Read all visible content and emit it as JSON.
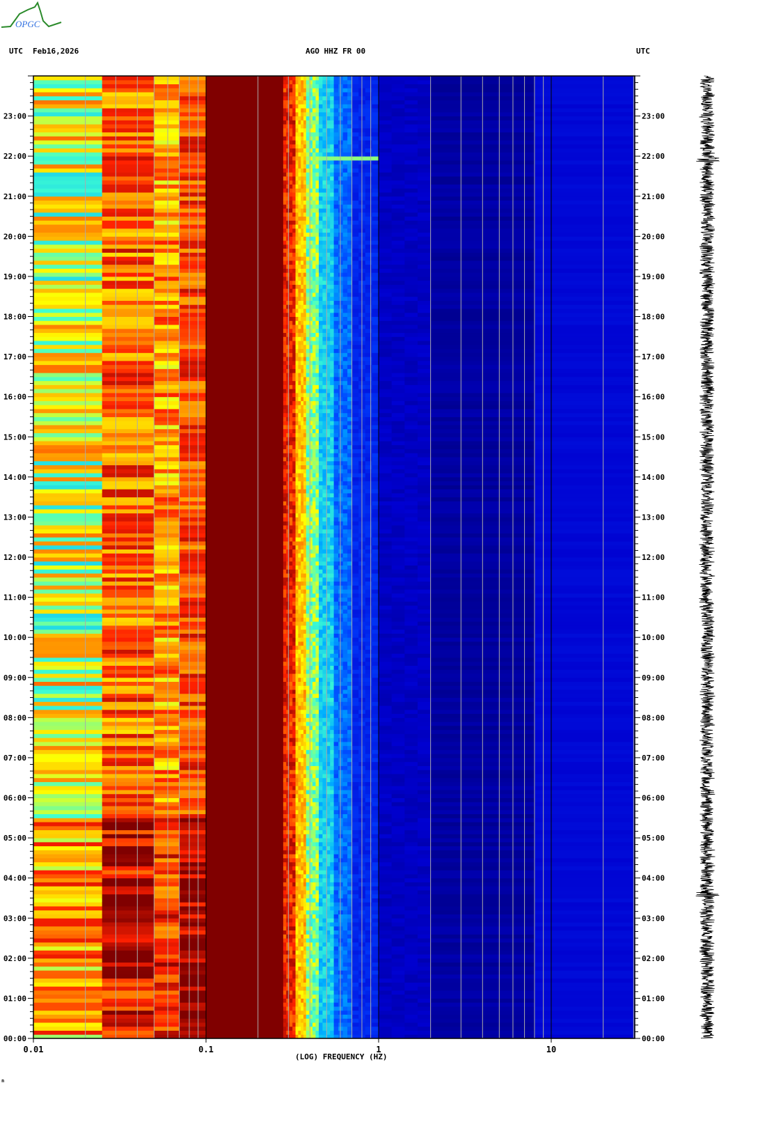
{
  "header": {
    "logo_text": "OPGC",
    "left_tz": "UTC",
    "date": "Feb16,2026",
    "station": "AGO HHZ FR 00",
    "right_tz": "UTC"
  },
  "footer_mark": "n",
  "chart_data": {
    "type": "heatmap",
    "title": "AGO HHZ FR 00",
    "xlabel": "(LOG) FREQUENCY (HZ)",
    "xscale": "log",
    "xlim": [
      0.01,
      30
    ],
    "x_ticks": [
      0.01,
      0.1,
      1,
      10
    ],
    "x_tick_labels": [
      "0.01",
      "0.1",
      "1",
      "10"
    ],
    "ylabel": "UTC",
    "ylim_hours": [
      0,
      24
    ],
    "y_tick_labels": [
      "00:00",
      "01:00",
      "02:00",
      "03:00",
      "04:00",
      "05:00",
      "06:00",
      "07:00",
      "08:00",
      "09:00",
      "10:00",
      "11:00",
      "12:00",
      "13:00",
      "14:00",
      "15:00",
      "16:00",
      "17:00",
      "18:00",
      "19:00",
      "20:00",
      "21:00",
      "22:00",
      "23:00"
    ],
    "colormap": [
      "#00008c",
      "#0000d0",
      "#0040ff",
      "#00b0ff",
      "#40ffd0",
      "#ffff00",
      "#ffa000",
      "#ff2000",
      "#800000"
    ],
    "bands": [
      {
        "f0": 0.01,
        "f1": 0.025,
        "level": 0.62,
        "noise": 0.18
      },
      {
        "f0": 0.025,
        "f1": 0.05,
        "level": 0.8,
        "noise": 0.14
      },
      {
        "f0": 0.05,
        "f1": 0.07,
        "level": 0.74,
        "noise": 0.14
      },
      {
        "f0": 0.07,
        "f1": 0.1,
        "level": 0.84,
        "noise": 0.1
      },
      {
        "f0": 0.1,
        "f1": 0.28,
        "level": 1.0,
        "noise": 0.0
      },
      {
        "f0": 0.28,
        "f1": 0.33,
        "level": 0.88,
        "noise": 0.08
      },
      {
        "f0": 0.33,
        "f1": 0.38,
        "level": 0.7,
        "noise": 0.08
      },
      {
        "f0": 0.38,
        "f1": 0.45,
        "level": 0.55,
        "noise": 0.08
      },
      {
        "f0": 0.45,
        "f1": 0.55,
        "level": 0.42,
        "noise": 0.06
      },
      {
        "f0": 0.55,
        "f1": 0.7,
        "level": 0.3,
        "noise": 0.05
      },
      {
        "f0": 0.7,
        "f1": 1.0,
        "level": 0.2,
        "noise": 0.03
      },
      {
        "f0": 1.0,
        "f1": 2.0,
        "level": 0.1,
        "noise": 0.03
      },
      {
        "f0": 2.0,
        "f1": 8.0,
        "level": 0.04,
        "noise": 0.03
      },
      {
        "f0": 8.0,
        "f1": 30,
        "level": 0.14,
        "noise": 0.01
      }
    ],
    "events": [
      {
        "time_hours": 21.9,
        "f0": 0.28,
        "f1": 1.5,
        "level": 0.55
      }
    ],
    "seismogram": "trace of HHZ channel over 24 h shown at right"
  }
}
